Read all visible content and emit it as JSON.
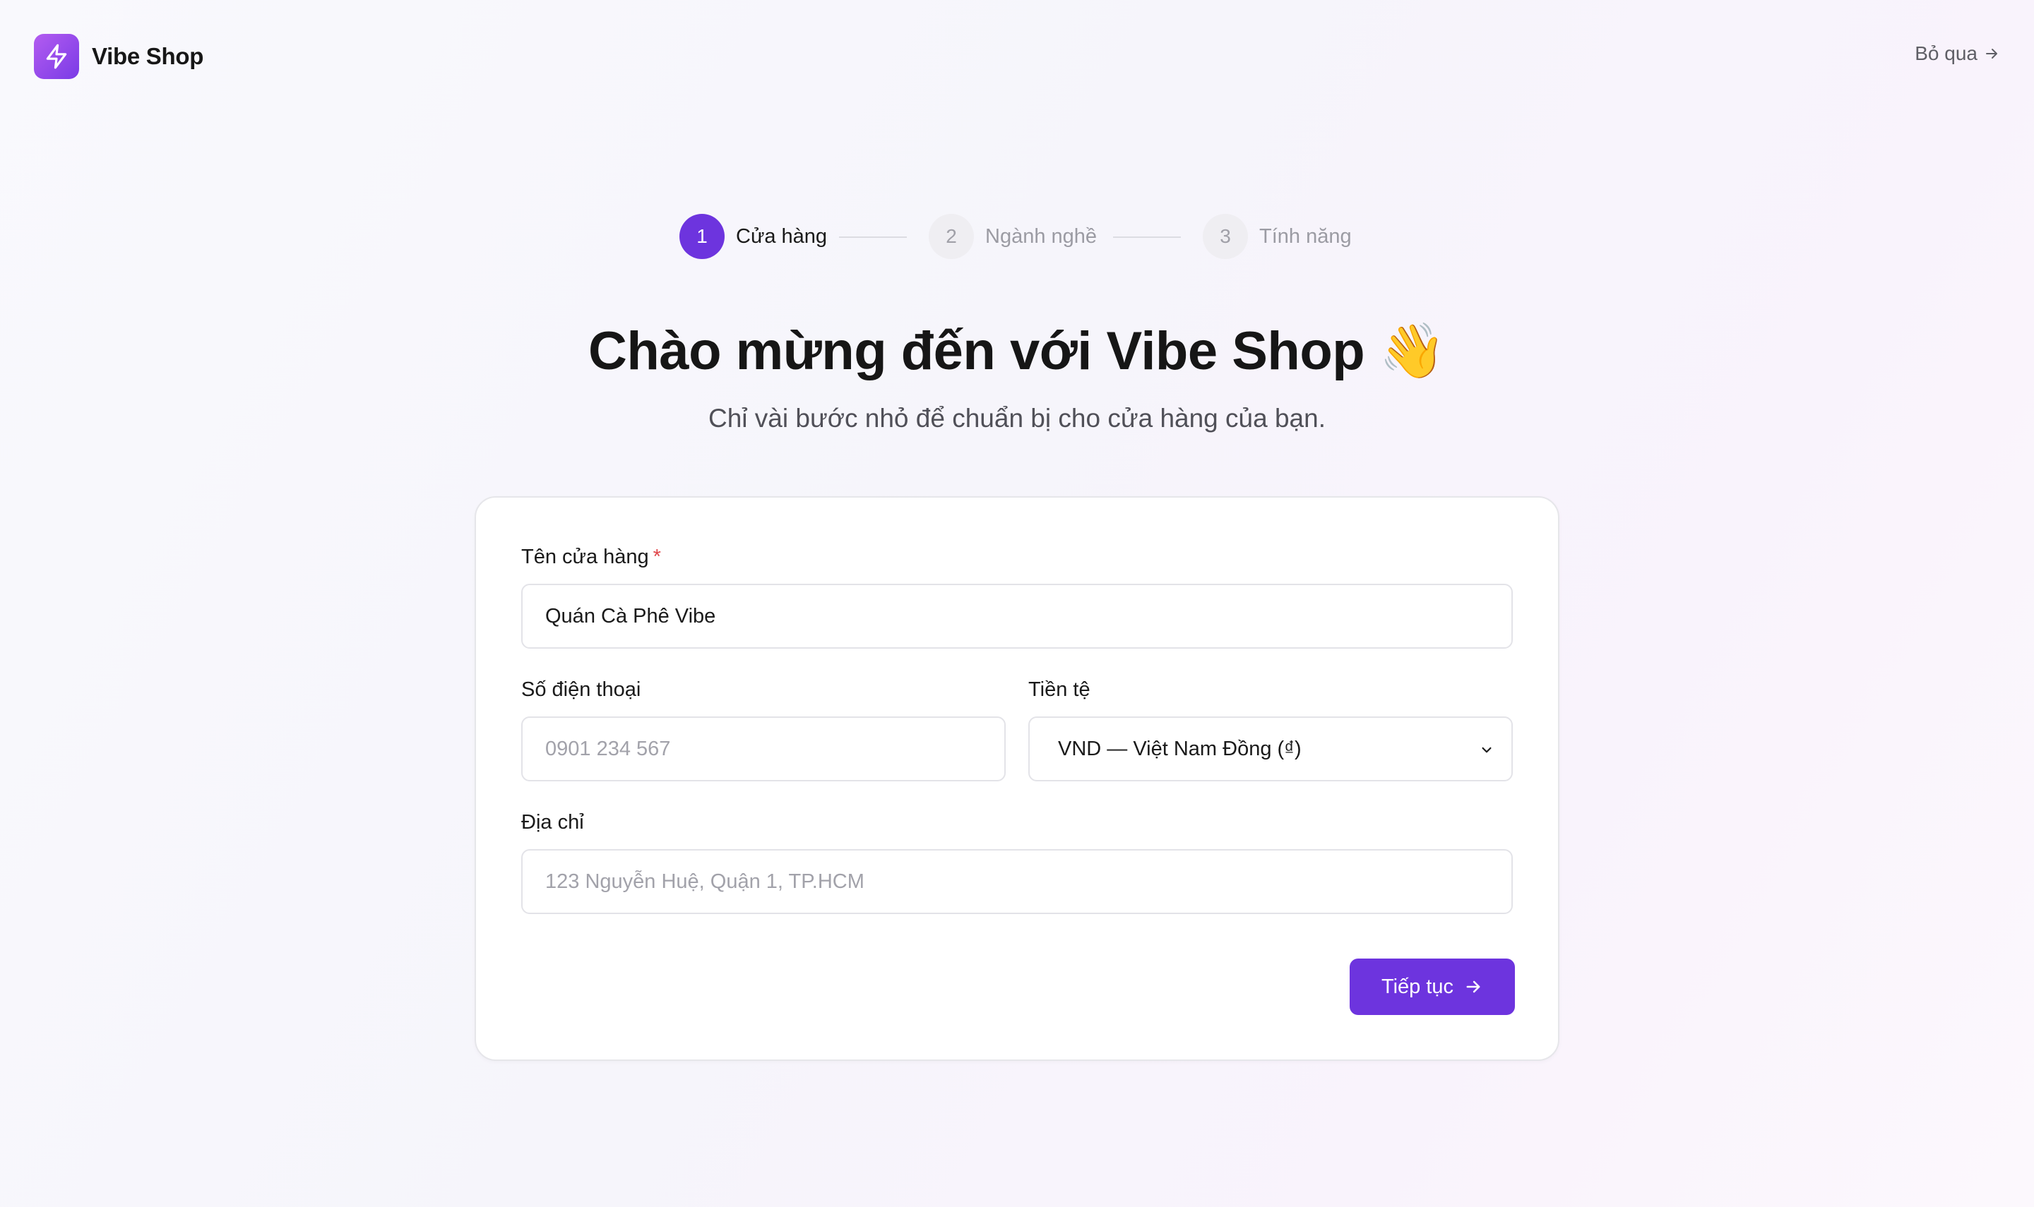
{
  "header": {
    "brand_name": "Vibe Shop",
    "skip_label": "Bỏ qua"
  },
  "stepper": {
    "steps": [
      {
        "number": "1",
        "label": "Cửa hàng",
        "state": "active"
      },
      {
        "number": "2",
        "label": "Ngành nghề",
        "state": "inactive"
      },
      {
        "number": "3",
        "label": "Tính năng",
        "state": "inactive"
      }
    ]
  },
  "hero": {
    "title": "Chào mừng đến với Vibe Shop 👋",
    "subtitle": "Chỉ vài bước nhỏ để chuẩn bị cho cửa hàng của bạn."
  },
  "form": {
    "store_name": {
      "label": "Tên cửa hàng",
      "required_mark": "*",
      "value": "Quán Cà Phê Vibe"
    },
    "phone": {
      "label": "Số điện thoại",
      "placeholder": "0901 234 567"
    },
    "currency": {
      "label": "Tiền tệ",
      "selected": "VND — Việt Nam Đồng (₫)"
    },
    "address": {
      "label": "Địa chỉ",
      "placeholder": "123 Nguyễn Huệ, Quận 1, TP.HCM"
    },
    "continue_label": "Tiếp tục"
  },
  "colors": {
    "accent": "#6d34de",
    "logo_gradient_start": "#b35cf0",
    "logo_gradient_end": "#7a3be6",
    "required": "#e0464a"
  },
  "icons": {
    "logo": "lightning-icon",
    "skip": "arrow-right-icon",
    "select": "chevron-down-icon",
    "continue": "arrow-right-icon"
  }
}
